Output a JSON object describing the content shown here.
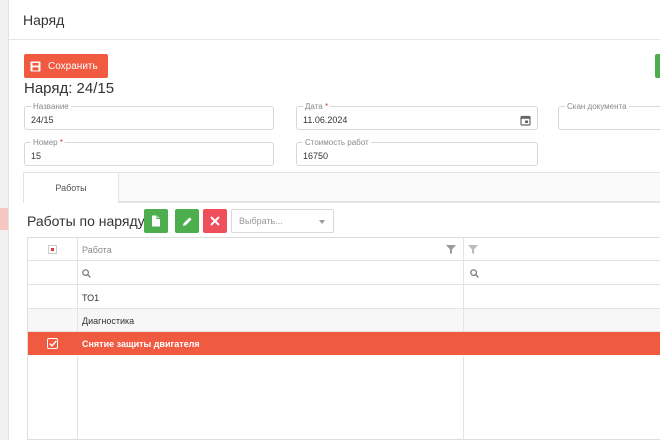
{
  "window": {
    "title": "Наряд"
  },
  "toolbar": {
    "save_label": "Сохранить"
  },
  "document": {
    "heading": "Наряд: 24/15"
  },
  "fields": {
    "name": {
      "label": "Название",
      "value": "24/15"
    },
    "date": {
      "label": "Дата",
      "required_mark": "*",
      "value": "11.06.2024"
    },
    "scan": {
      "label": "Скан документа",
      "value": ""
    },
    "number": {
      "label": "Номер",
      "required_mark": "*",
      "value": "15"
    },
    "cost": {
      "label": "Стоимость работ",
      "value": "16750"
    }
  },
  "tabs": [
    {
      "label": "Работы",
      "active": true
    }
  ],
  "works": {
    "title": "Работы по наряду",
    "select_placeholder": "Выбрать...",
    "columns": [
      "Работа",
      ""
    ],
    "rows": [
      {
        "work": "ТО1",
        "selected": false
      },
      {
        "work": "Диагностика",
        "selected": false
      },
      {
        "work": "Снятие защиты двигателя",
        "selected": true
      }
    ]
  },
  "colors": {
    "accent": "#f05a40",
    "green": "#4cae4c",
    "delete": "#ef4f5b"
  },
  "icons": [
    "save-icon",
    "calendar-icon",
    "new-document-icon",
    "pencil-icon",
    "close-icon",
    "chevron-down-icon",
    "filter-icon",
    "search-icon",
    "checkbox-icon"
  ]
}
